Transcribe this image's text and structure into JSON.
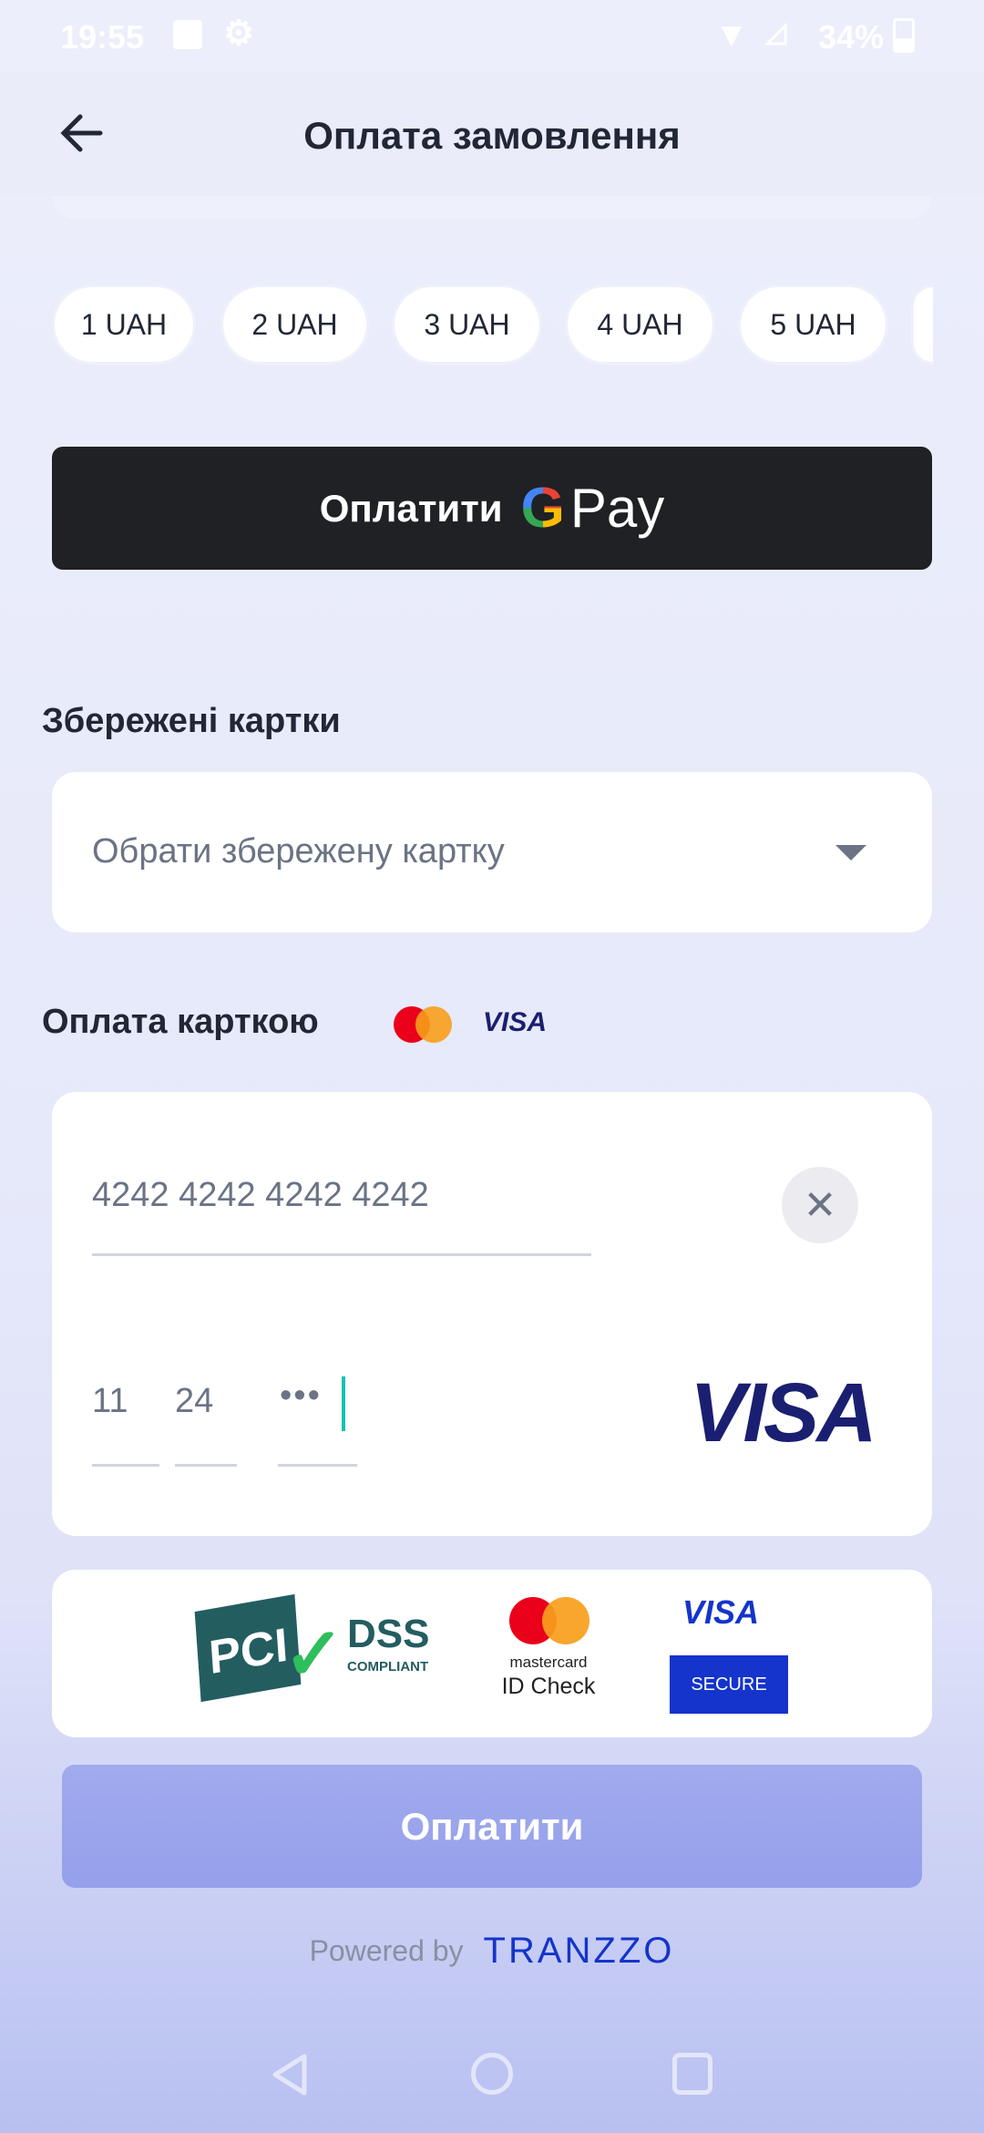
{
  "status_bar": {
    "time": "19:55",
    "battery": "34%"
  },
  "header": {
    "title": "Оплата замовлення"
  },
  "amount_chips": [
    "1 UAH",
    "2 UAH",
    "3 UAH",
    "4 UAH",
    "5 UAH"
  ],
  "gpay": {
    "label": "Оплатити",
    "pay_text": "Pay"
  },
  "saved_cards": {
    "heading": "Збережені картки",
    "placeholder": "Обрати збережену картку"
  },
  "card_payment": {
    "heading": "Оплата карткою",
    "card_number": "4242 4242 4242 4242",
    "exp_month": "11",
    "exp_year": "24",
    "cvv_masked": "•••",
    "brand": "VISA"
  },
  "trust": {
    "pci": "PCI",
    "dss": "DSS",
    "compliant": "COMPLIANT",
    "mastercard": "mastercard",
    "id_check": "ID Check",
    "visa": "VISA",
    "secure": "SECURE"
  },
  "pay_button": {
    "label": "Оплатити"
  },
  "footer": {
    "powered_by": "Powered by",
    "brand": "TRANZZO"
  },
  "colors": {
    "pay_button": "#9aa5ec",
    "visa": "#1a1f71",
    "secure": "#1434cb"
  }
}
